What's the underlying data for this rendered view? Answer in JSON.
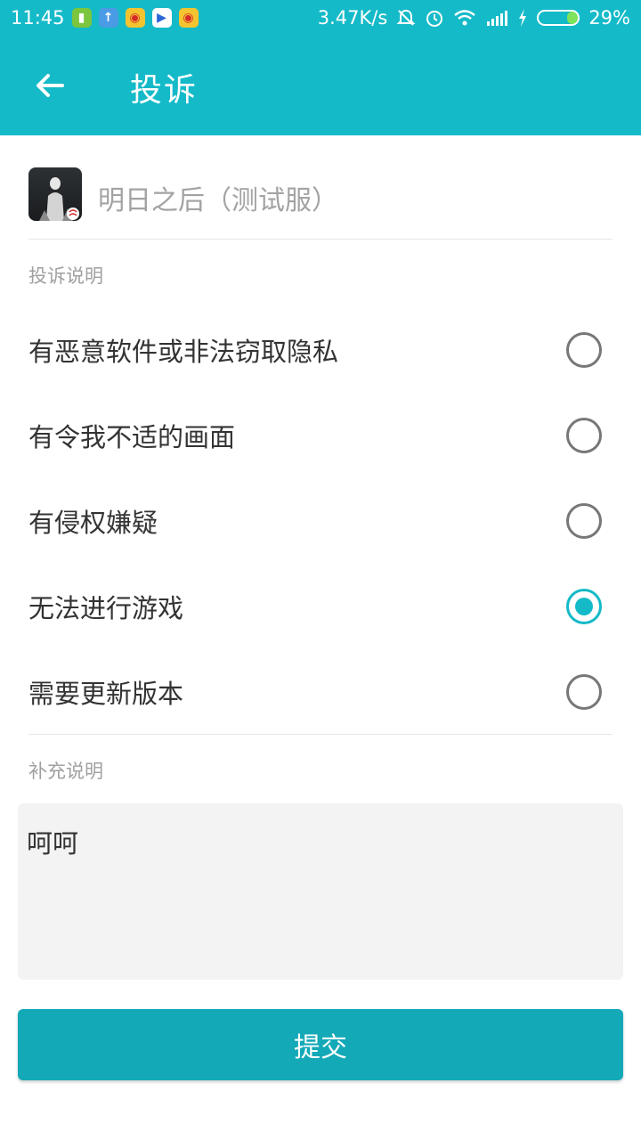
{
  "status_bar": {
    "time": "11:45",
    "speed": "3.47K/s",
    "battery": "29%",
    "battery_level": 0.29,
    "notification_icons": [
      "battery-app-icon",
      "upload-icon",
      "weibo-icon",
      "video-app-icon",
      "weibo-icon"
    ],
    "system_icons": [
      "mute-icon",
      "alarm-icon",
      "wifi-icon",
      "signal-icon",
      "charging-icon",
      "battery-icon"
    ]
  },
  "app_bar": {
    "title": "投诉",
    "back_icon": "arrow-left-icon"
  },
  "game": {
    "name": "明日之后（测试服）",
    "icon": "game-icon"
  },
  "complaint_section": {
    "label": "投诉说明",
    "options": [
      {
        "label": "有恶意软件或非法窃取隐私",
        "selected": false
      },
      {
        "label": "有令我不适的画面",
        "selected": false
      },
      {
        "label": "有侵权嫌疑",
        "selected": false
      },
      {
        "label": "无法进行游戏",
        "selected": true
      },
      {
        "label": "需要更新版本",
        "selected": false
      }
    ]
  },
  "supplement_section": {
    "label": "补充说明",
    "value": "呵呵"
  },
  "submit_label": "提交",
  "colors": {
    "primary": "#14bac8",
    "button": "#13a9b7",
    "text": "#333333",
    "hint": "#a0a0a0",
    "input_bg": "#f3f3f3"
  }
}
